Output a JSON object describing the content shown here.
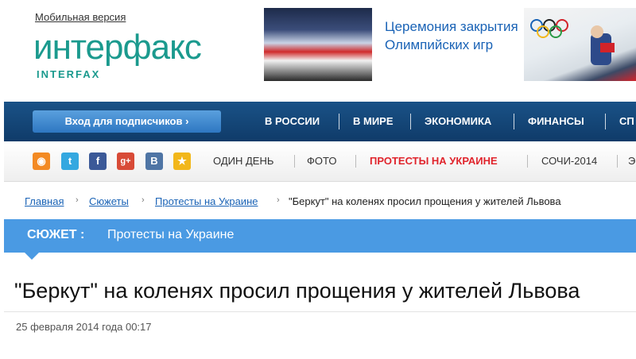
{
  "header": {
    "mobile_link": "Мобильная версия",
    "logo_main": "интерфакс",
    "logo_sub": "INTERFAX",
    "promo_text": "Церемония закрытия Олимпийских игр"
  },
  "nav": {
    "login_button": "Вход для подписчиков ›",
    "items": [
      "В РОССИИ",
      "В МИРЕ",
      "ЭКОНОМИКА",
      "ФИНАНСЫ",
      "СП"
    ]
  },
  "social": {
    "icons": [
      "rss-icon",
      "twitter-icon",
      "facebook-icon",
      "google-plus-icon",
      "vk-icon",
      "favorites-star-icon"
    ],
    "glyphs": [
      "◉",
      "t",
      "f",
      "g+",
      "В",
      "★"
    ],
    "colors": [
      "#f38a23",
      "#34a8e0",
      "#3b5998",
      "#d84b37",
      "#4f75a5",
      "#f2b71a"
    ]
  },
  "sections": {
    "items": [
      "ОДИН ДЕНЬ",
      "ФОТО",
      "ПРОТЕСТЫ НА УКРАИНЕ",
      "СОЧИ-2014",
      "ЭКС"
    ],
    "active_color": "#e0242c"
  },
  "breadcrumb": {
    "home": "Главная",
    "stories": "Сюжеты",
    "topic": "Протесты на Украине",
    "current": "\"Беркут\" на коленях просил прощения у жителей Львова",
    "sep": "›"
  },
  "story": {
    "label": "СЮЖЕТ :",
    "value": "Протесты на Украине"
  },
  "article": {
    "headline": "\"Беркут\" на коленях просил прощения у жителей Львова",
    "date": "25 февраля 2014 года 00:17"
  }
}
